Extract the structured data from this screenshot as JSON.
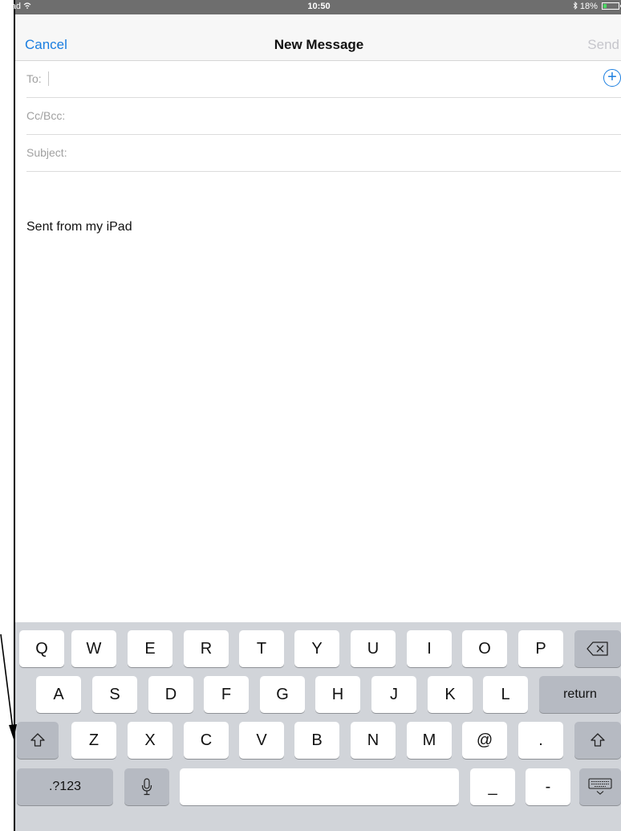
{
  "status_bar": {
    "device": "iPad",
    "time": "10:50",
    "battery": "18%"
  },
  "nav": {
    "cancel": "Cancel",
    "title": "New Message",
    "send": "Send"
  },
  "fields": {
    "to": "To:",
    "ccbcc": "Cc/Bcc:",
    "subject": "Subject:"
  },
  "body": {
    "signature": "Sent from my iPad"
  },
  "keyboard": {
    "row1": [
      "Q",
      "W",
      "E",
      "R",
      "T",
      "Y",
      "U",
      "I",
      "O",
      "P"
    ],
    "row2": [
      "A",
      "S",
      "D",
      "F",
      "G",
      "H",
      "J",
      "K",
      "L"
    ],
    "row3": [
      "Z",
      "X",
      "C",
      "V",
      "B",
      "N",
      "M",
      "@",
      "."
    ],
    "return": "return",
    "numbers": ".?123",
    "underscore": "_",
    "dash": "-"
  },
  "icons": {
    "wifi": "wifi-icon",
    "bluetooth": "bluetooth-icon",
    "battery": "battery-icon",
    "add_contact": "plus-circle-icon",
    "backspace": "backspace-icon",
    "shift": "shift-arrow-icon",
    "microphone": "microphone-icon",
    "hide_keyboard": "keyboard-hide-icon"
  }
}
